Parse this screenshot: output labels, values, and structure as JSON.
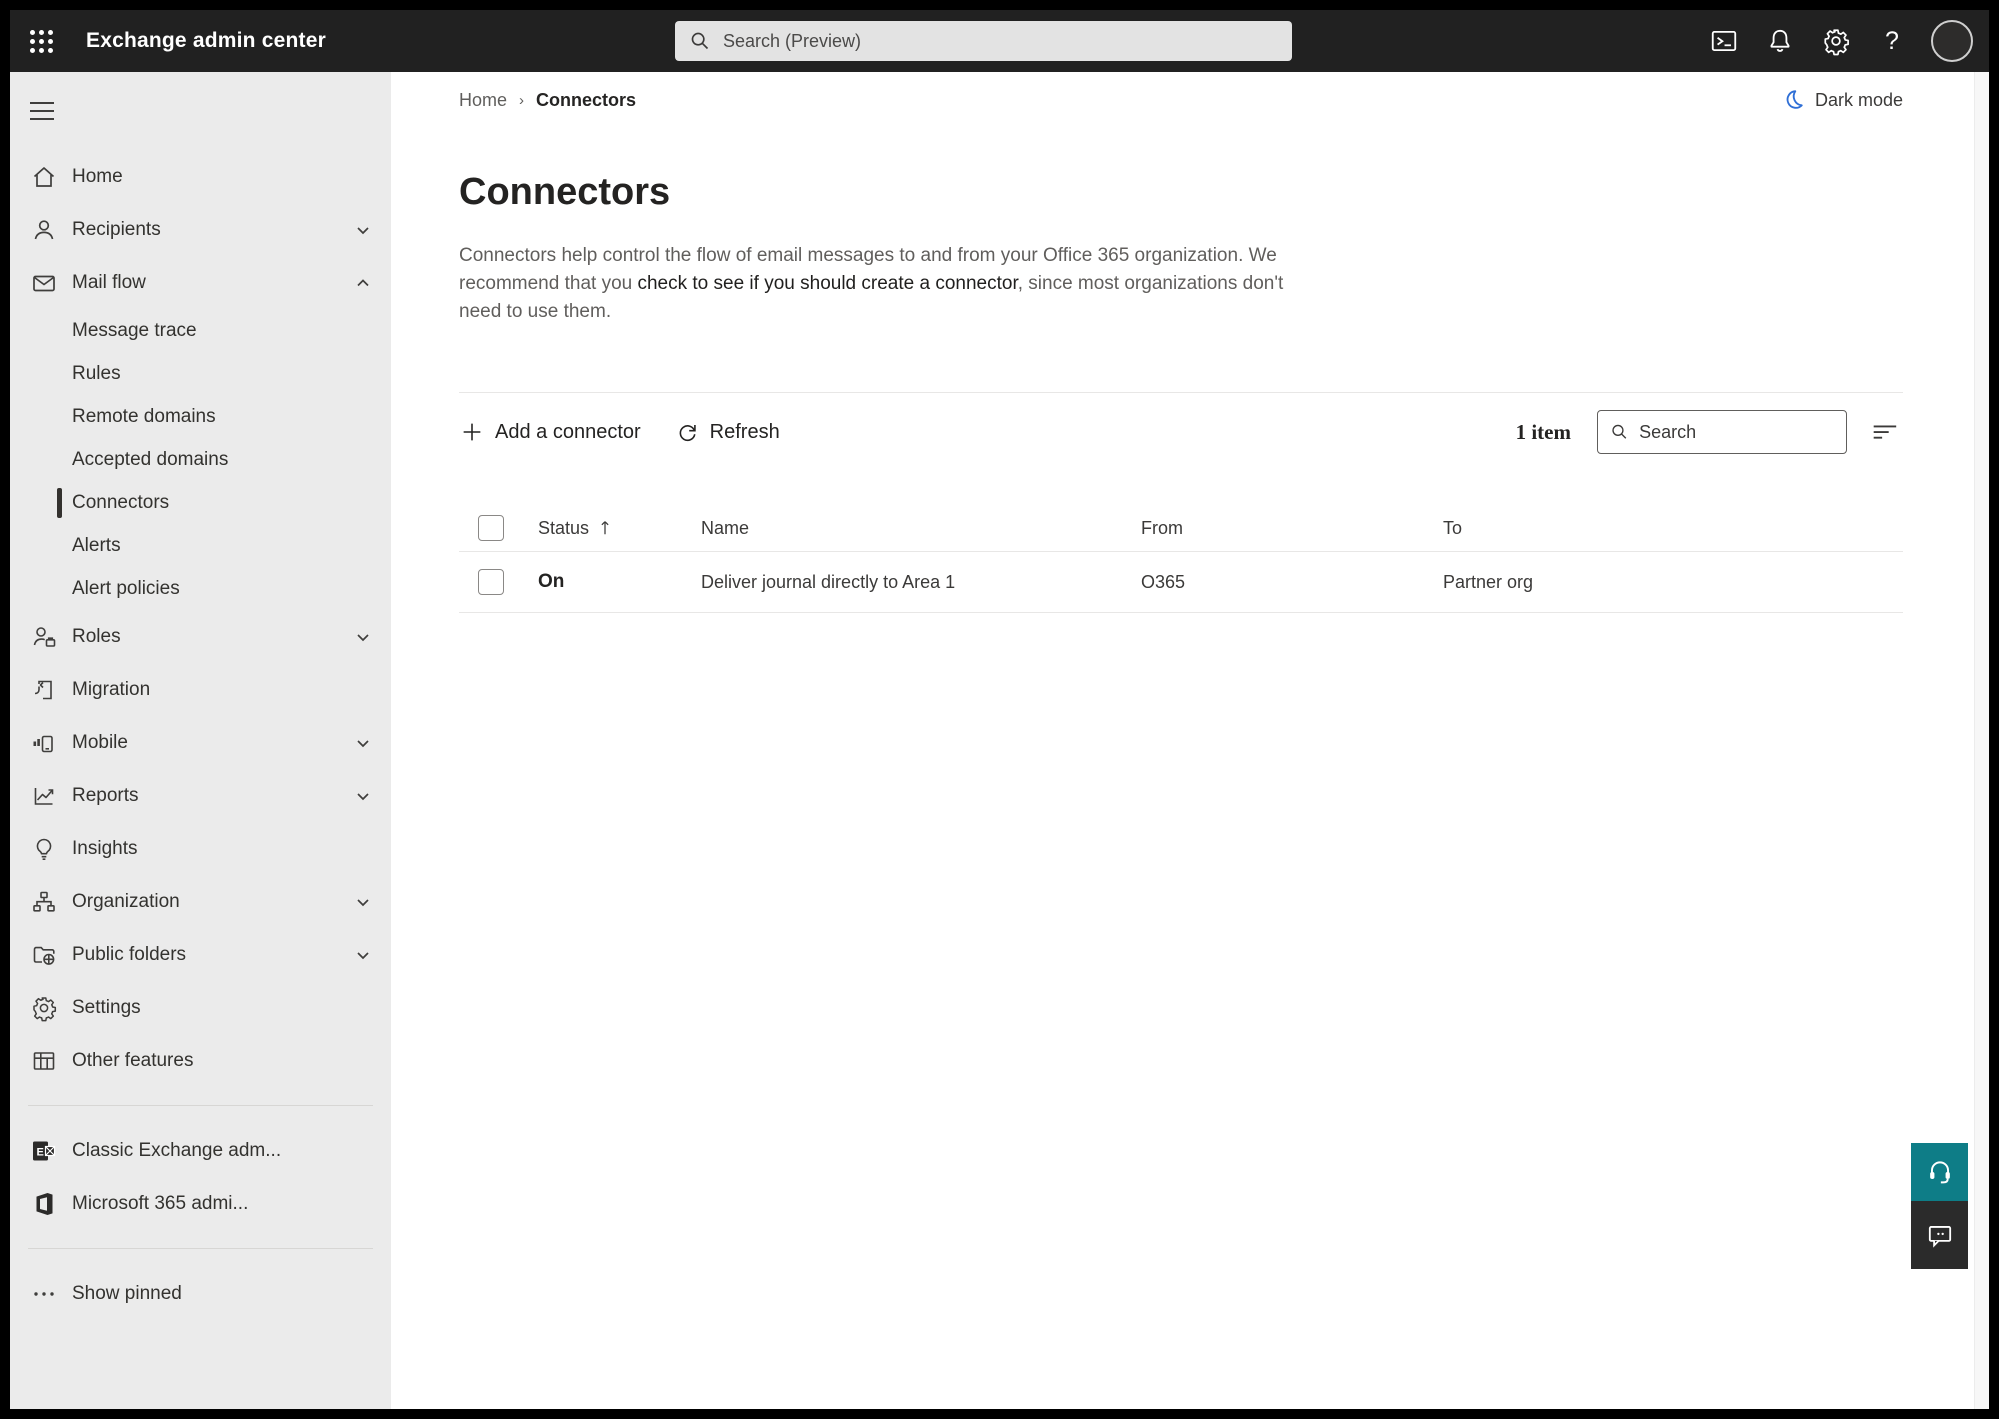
{
  "topbar": {
    "title": "Exchange admin center",
    "search_placeholder": "Search (Preview)"
  },
  "sidebar": {
    "items": [
      {
        "label": "Home"
      },
      {
        "label": "Recipients"
      },
      {
        "label": "Mail flow"
      },
      {
        "label": "Message trace"
      },
      {
        "label": "Rules"
      },
      {
        "label": "Remote domains"
      },
      {
        "label": "Accepted domains"
      },
      {
        "label": "Connectors"
      },
      {
        "label": "Alerts"
      },
      {
        "label": "Alert policies"
      },
      {
        "label": "Roles"
      },
      {
        "label": "Migration"
      },
      {
        "label": "Mobile"
      },
      {
        "label": "Reports"
      },
      {
        "label": "Insights"
      },
      {
        "label": "Organization"
      },
      {
        "label": "Public folders"
      },
      {
        "label": "Settings"
      },
      {
        "label": "Other features"
      },
      {
        "label": "Classic Exchange adm..."
      },
      {
        "label": "Microsoft 365 admi..."
      },
      {
        "label": "Show pinned"
      }
    ]
  },
  "main": {
    "breadcrumb": [
      "Home",
      "Connectors"
    ],
    "dark_mode_label": "Dark mode",
    "title": "Connectors",
    "description": [
      "Connectors help control the flow of email messages to and from your Office 365 organization. We recommend that you ",
      "check to see if you should create a connector",
      ", since most organizations don't need to use them."
    ],
    "toolbar": {
      "add_label": "Add a connector",
      "refresh_label": "Refresh",
      "count": "1 item",
      "search_placeholder": "Search"
    },
    "table": {
      "columns": [
        "Status",
        "Name",
        "From",
        "To"
      ],
      "rows": [
        {
          "status": "On",
          "name": "Deliver journal directly to Area 1",
          "from": "O365",
          "to": "Partner org"
        }
      ]
    }
  },
  "colors": {
    "topbar_bg": "#212121",
    "sidebar_bg": "#ebebeb",
    "accent_teal": "#0e7d87",
    "darkmode_blue": "#2f6fd6",
    "selected_indicator": "#33312e"
  }
}
